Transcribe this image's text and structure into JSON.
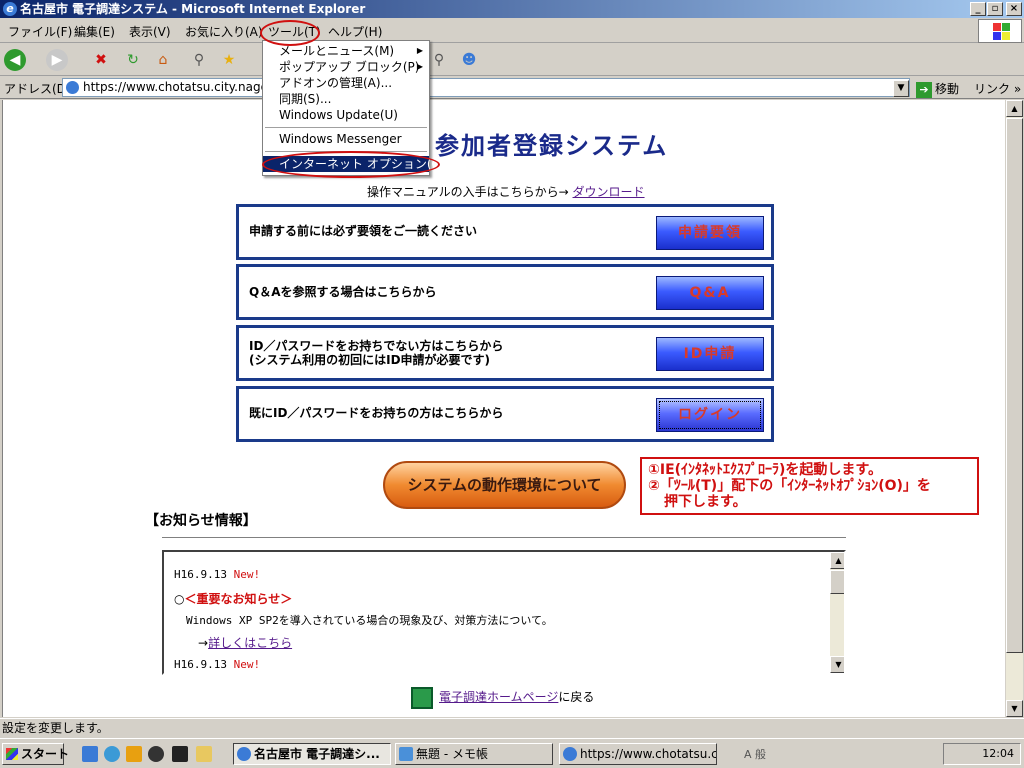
{
  "window": {
    "title": "名古屋市 電子調達システム - Microsoft Internet Explorer"
  },
  "menubar": [
    "ファイル(F)",
    "編集(E)",
    "表示(V)",
    "お気に入り(A)",
    "ツール(T)",
    "ヘルプ(H)"
  ],
  "address": {
    "label": "アドレス(D)",
    "url": "https://www.chotatsu.city.nagoya.jp",
    "go": "移動",
    "links": "リンク"
  },
  "tools_menu": {
    "items": [
      "メールとニュース(M)",
      "ポップアップ ブロック(P)",
      "アドオンの管理(A)...",
      "同期(S)...",
      "Windows Update(U)",
      "Windows Messenger",
      "インターネット オプション(O)..."
    ]
  },
  "page": {
    "title": "参加者登録システム",
    "manual_text": "操作マニュアルの入手はこちらから→",
    "manual_link": "ダウンロード",
    "rows": [
      {
        "text": "申請する前には必ず要領をご一読ください",
        "button": "申請要領"
      },
      {
        "text": "Q＆Aを参照する場合はこちらから",
        "button": "Q&A"
      },
      {
        "text1": "ID／パスワードをお持ちでない方はこちらから",
        "text2": "(システム利用の初回にはID申請が必要です)",
        "button": "ID申請"
      },
      {
        "text": "既にID／パスワードをお持ちの方はこちらから",
        "button": "ログイン"
      }
    ],
    "env_button": "システムの動作環境について",
    "note": {
      "line1": "①IE(ｲﾝﾀﾈｯﾄｴｸｽﾌﾟﾛｰﾗ)を起動します。",
      "line2": "②「ﾂｰﾙ(T)」配下の「ｲﾝﾀｰﾈｯﾄｵﾌﾟｼｮﾝ(O)」を",
      "line3": "押下します。"
    },
    "notice_heading": "【お知らせ情報】",
    "news": {
      "date1": "H16.9.13",
      "new1": "New!",
      "important_mark": "○",
      "important": "＜重要なお知らせ＞",
      "body": "Windows XP SP2を導入されている場合の現象及び、対策方法について。",
      "arrow": "→",
      "detail_link": "詳しくはこちら",
      "date2": "H16.9.13",
      "new2": "New!"
    },
    "footer_link": "電子調達ホームページ",
    "footer_suffix": "に戻る"
  },
  "status": {
    "text": "設定を変更します。"
  },
  "taskbar": {
    "start": "スタート",
    "tasks": [
      "名古屋市 電子調達シ...",
      "無題 - メモ帳",
      "https://www.chotatsu.cit..."
    ],
    "ime": "A 般",
    "clock": "12:04"
  }
}
